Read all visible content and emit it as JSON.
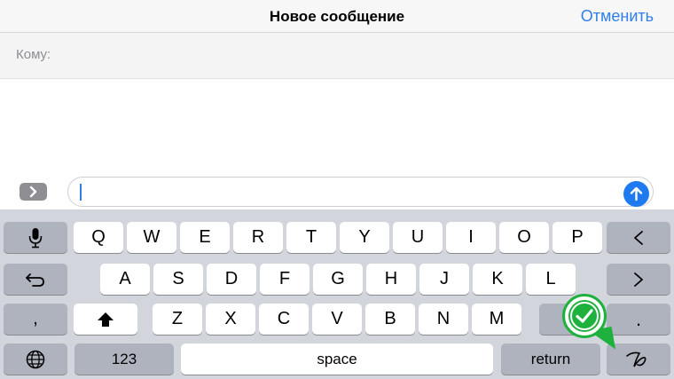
{
  "navbar": {
    "title": "Новое сообщение",
    "cancel": "Отменить"
  },
  "to_field": {
    "label": "Кому:"
  },
  "compose": {
    "value": "",
    "placeholder": ""
  },
  "colors": {
    "accent": "#2f7fe6",
    "send": "#1f7af0",
    "keyboard_bg": "#d2d5db",
    "badge": "#1fb13e"
  },
  "keyboard": {
    "row1": [
      "Q",
      "W",
      "E",
      "R",
      "T",
      "Y",
      "U",
      "I",
      "O",
      "P"
    ],
    "row2": [
      "A",
      "S",
      "D",
      "F",
      "G",
      "H",
      "J",
      "K",
      "L"
    ],
    "row3": [
      "Z",
      "X",
      "C",
      "V",
      "B",
      "N",
      "M"
    ],
    "comma": ",",
    "period": ".",
    "numbers": "123",
    "space": "space",
    "return": "return",
    "icons": [
      "microphone-icon",
      "backspace-icon",
      "undo-icon",
      "redo-icon",
      "shift-icon",
      "globe-icon",
      "handwriting-icon",
      "checkmark-icon"
    ]
  }
}
